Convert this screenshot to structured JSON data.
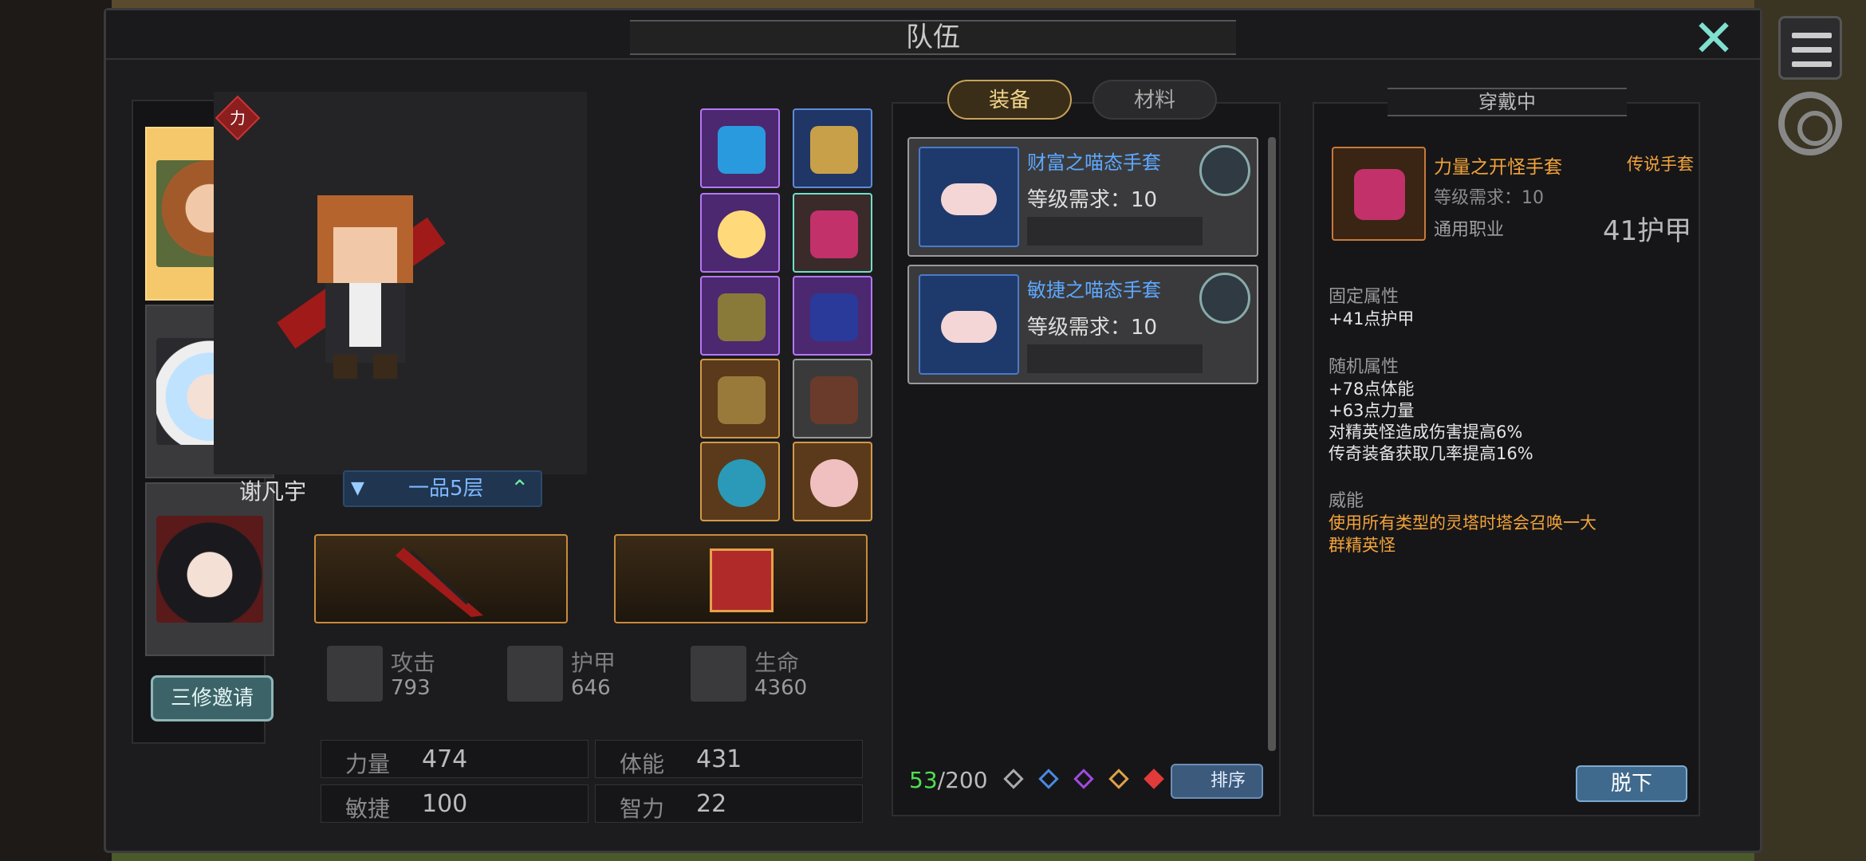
{
  "window_title": "队伍",
  "heroes": {
    "invite_label": "三修邀请"
  },
  "character": {
    "attribute_tag": "力",
    "name": "谢凡宇",
    "rank": "一品5层"
  },
  "stats": {
    "attack": {
      "label": "攻击",
      "value": "793"
    },
    "armor": {
      "label": "护甲",
      "value": "646"
    },
    "life": {
      "label": "生命",
      "value": "4360"
    }
  },
  "attributes": [
    {
      "label": "力量",
      "value": "474"
    },
    {
      "label": "体能",
      "value": "431"
    },
    {
      "label": "敏捷",
      "value": "100"
    },
    {
      "label": "智力",
      "value": "22"
    }
  ],
  "inventory": {
    "tabs": [
      "装备",
      "材料"
    ],
    "active_tab": "装备",
    "items": [
      {
        "name": "财富之喵态手套",
        "req": "等级需求：10"
      },
      {
        "name": "敏捷之喵态手套",
        "req": "等级需求：10"
      }
    ],
    "count_current": "53",
    "count_total": "/200",
    "sort_label": "排序"
  },
  "detail": {
    "header": "穿戴中",
    "name": "力量之开怪手套",
    "type": "传说手套",
    "req": "等级需求：10",
    "class": "通用职业",
    "armor": "41护甲",
    "fixed_title": "固定属性",
    "fixed_lines": [
      "+41点护甲"
    ],
    "random_title": "随机属性",
    "random_lines": [
      "+78点体能",
      "+63点力量",
      "对精英怪造成伤害提高6%",
      "传奇装备获取几率提高16%"
    ],
    "power_title": "威能",
    "power_lines": [
      "使用所有类型的灵塔时塔会召唤一大",
      "群精英怪"
    ],
    "takeoff_label": "脱下"
  },
  "colors": {
    "accent_gold": "#f3a33a",
    "accent_blue": "#5da8ff",
    "count_green": "#4fe04f"
  }
}
